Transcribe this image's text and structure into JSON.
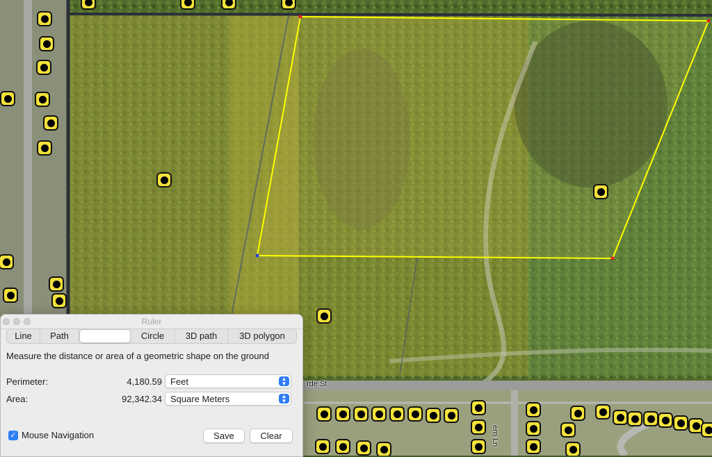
{
  "map": {
    "street_label": "rde St",
    "street_label_2": "ern Ln",
    "polygon_color": "#ffff00",
    "marker_color": "#f2e23a"
  },
  "ruler": {
    "title": "Ruler",
    "tabs": [
      "Line",
      "Path",
      "",
      "Circle",
      "3D path",
      "3D polygon"
    ],
    "selected_tab_index": 2,
    "description": "Measure the distance or area of a geometric shape on the ground",
    "perimeter": {
      "label": "Perimeter:",
      "value": "4,180.59",
      "unit": "Feet"
    },
    "area": {
      "label": "Area:",
      "value": "92,342.34",
      "unit": "Square Meters"
    },
    "mouse_navigation": {
      "label": "Mouse Navigation",
      "checked": true
    },
    "save_label": "Save",
    "clear_label": "Clear"
  }
}
